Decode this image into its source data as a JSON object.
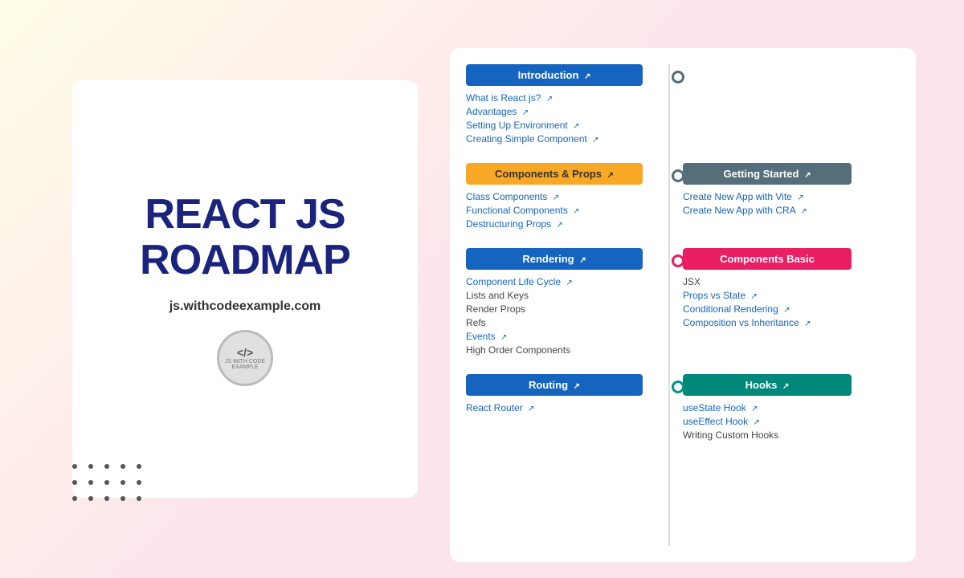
{
  "left_panel": {
    "title_line1": "REACT JS",
    "title_line2": "ROADMAP",
    "subtitle": "js.withcodeexample.com",
    "logo_code": "</>",
    "logo_sub": "JS WITH CODE EXAMPLE"
  },
  "roadmap": {
    "sections": [
      {
        "id": "introduction",
        "left_header": "Introduction",
        "left_header_style": "header-blue",
        "left_items": [
          {
            "text": "What is React js?",
            "link": true
          },
          {
            "text": "Advantages",
            "link": true
          },
          {
            "text": "Setting Up Environment",
            "link": true
          },
          {
            "text": "Creating Simple Component",
            "link": true
          }
        ],
        "right_header": null,
        "right_items": [],
        "node_style": "dark"
      },
      {
        "id": "components-props",
        "left_header": "Components & Props",
        "left_header_style": "header-yellow",
        "left_items": [
          {
            "text": "Class Components",
            "link": true
          },
          {
            "text": "Functional Components",
            "link": true
          },
          {
            "text": "Destructuring Props",
            "link": true
          }
        ],
        "right_header": "Getting Started",
        "right_header_style": "header-slate",
        "right_items": [
          {
            "text": "Create New App with Vite",
            "link": true
          },
          {
            "text": "Create New App with CRA",
            "link": true
          }
        ],
        "node_style": "dark"
      },
      {
        "id": "rendering",
        "left_header": "Rendering",
        "left_header_style": "header-blue",
        "left_items": [
          {
            "text": "Component Life Cycle",
            "link": true
          },
          {
            "text": "Lists and Keys",
            "link": false
          },
          {
            "text": "Render Props",
            "link": false
          },
          {
            "text": "Refs",
            "link": false
          },
          {
            "text": "Events",
            "link": true
          },
          {
            "text": "High Order Components",
            "link": false
          }
        ],
        "right_header": "Components Basic",
        "right_header_style": "header-pink",
        "right_items": [
          {
            "text": "JSX",
            "link": false
          },
          {
            "text": "Props vs State",
            "link": true
          },
          {
            "text": "Conditional Rendering",
            "link": true
          },
          {
            "text": "Composition vs Inheritance",
            "link": true
          }
        ],
        "node_style": "pink"
      },
      {
        "id": "routing",
        "left_header": "Routing",
        "left_header_style": "header-blue",
        "left_items": [
          {
            "text": "React Router",
            "link": true
          }
        ],
        "right_header": "Hooks",
        "right_header_style": "header-teal",
        "right_items": [
          {
            "text": "useState Hook",
            "link": true
          },
          {
            "text": "useEffect Hook",
            "link": true
          },
          {
            "text": "Writing Custom Hooks",
            "link": false
          }
        ],
        "node_style": "teal"
      }
    ]
  }
}
